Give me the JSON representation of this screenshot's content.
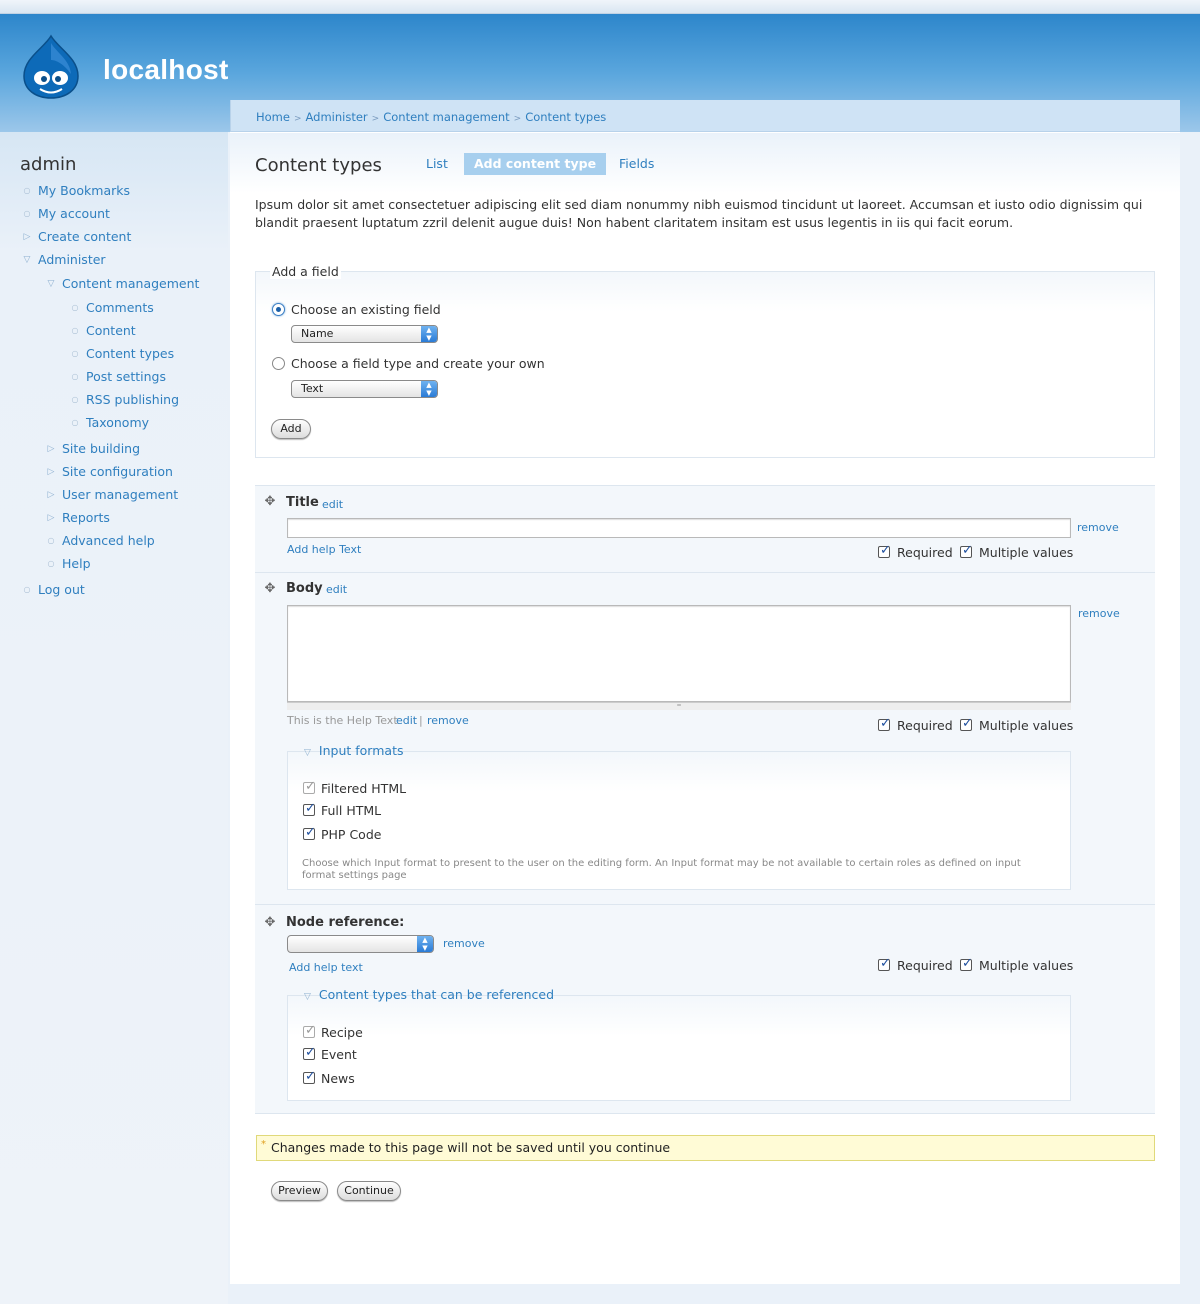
{
  "site": {
    "name": "localhost"
  },
  "sidebar": {
    "title": "admin",
    "items": [
      {
        "label": "My Bookmarks"
      },
      {
        "label": "My account"
      },
      {
        "label": "Create content"
      },
      {
        "label": "Administer"
      },
      {
        "label": "Content management"
      },
      {
        "label": "Comments"
      },
      {
        "label": "Content"
      },
      {
        "label": "Content types"
      },
      {
        "label": "Post settings"
      },
      {
        "label": "RSS publishing"
      },
      {
        "label": "Taxonomy"
      },
      {
        "label": "Site building"
      },
      {
        "label": "Site configuration"
      },
      {
        "label": "User management"
      },
      {
        "label": "Reports"
      },
      {
        "label": "Advanced help"
      },
      {
        "label": "Help"
      },
      {
        "label": "Log out"
      }
    ]
  },
  "breadcrumb": [
    "Home",
    "Administer",
    "Content management",
    "Content types"
  ],
  "page": {
    "title": "Content types",
    "tabs": [
      {
        "label": "List"
      },
      {
        "label": "Add content type"
      },
      {
        "label": "Fields"
      }
    ],
    "intro": "Ipsum dolor sit amet consectetuer adipiscing elit sed diam nonummy nibh euismod tincidunt ut laoreet. Accumsan et iusto odio dignissim qui blandit praesent luptatum zzril delenit augue duis! Non habent claritatem insitam est usus legentis in iis qui facit eorum."
  },
  "add_field": {
    "legend": "Add a field",
    "existing_label": "Choose an existing field",
    "existing_value": "Name",
    "new_label": "Choose a field type and create your own",
    "new_value": "Text",
    "add_button": "Add"
  },
  "fields": {
    "title": {
      "name": "Title",
      "edit": "edit",
      "remove": "remove",
      "help_link": "Add help Text",
      "required": "Required",
      "multiple": "Multiple values"
    },
    "body": {
      "name": "Body",
      "edit": "edit",
      "remove": "remove",
      "help_text": "This is the Help Text",
      "help_edit": "edit",
      "help_sep": "|",
      "help_remove": "remove",
      "required": "Required",
      "multiple": "Multiple values",
      "formats_legend": "Input formats",
      "formats": [
        "Filtered HTML",
        "Full HTML",
        "PHP Code"
      ],
      "formats_desc": "Choose which Input format to present to the user on the editing form. An Input format may be not available to certain roles as defined on input format settings page"
    },
    "node_ref": {
      "name": "Node reference:",
      "remove": "remove",
      "help_link": "Add help text",
      "required": "Required",
      "multiple": "Multiple values",
      "types_legend": "Content types that can be referenced",
      "types": [
        "Recipe",
        "Event",
        "News"
      ]
    }
  },
  "warning": {
    "star": "*",
    "text": "Changes made to this page will not be saved until you continue"
  },
  "actions": {
    "preview": "Preview",
    "continue": "Continue"
  }
}
